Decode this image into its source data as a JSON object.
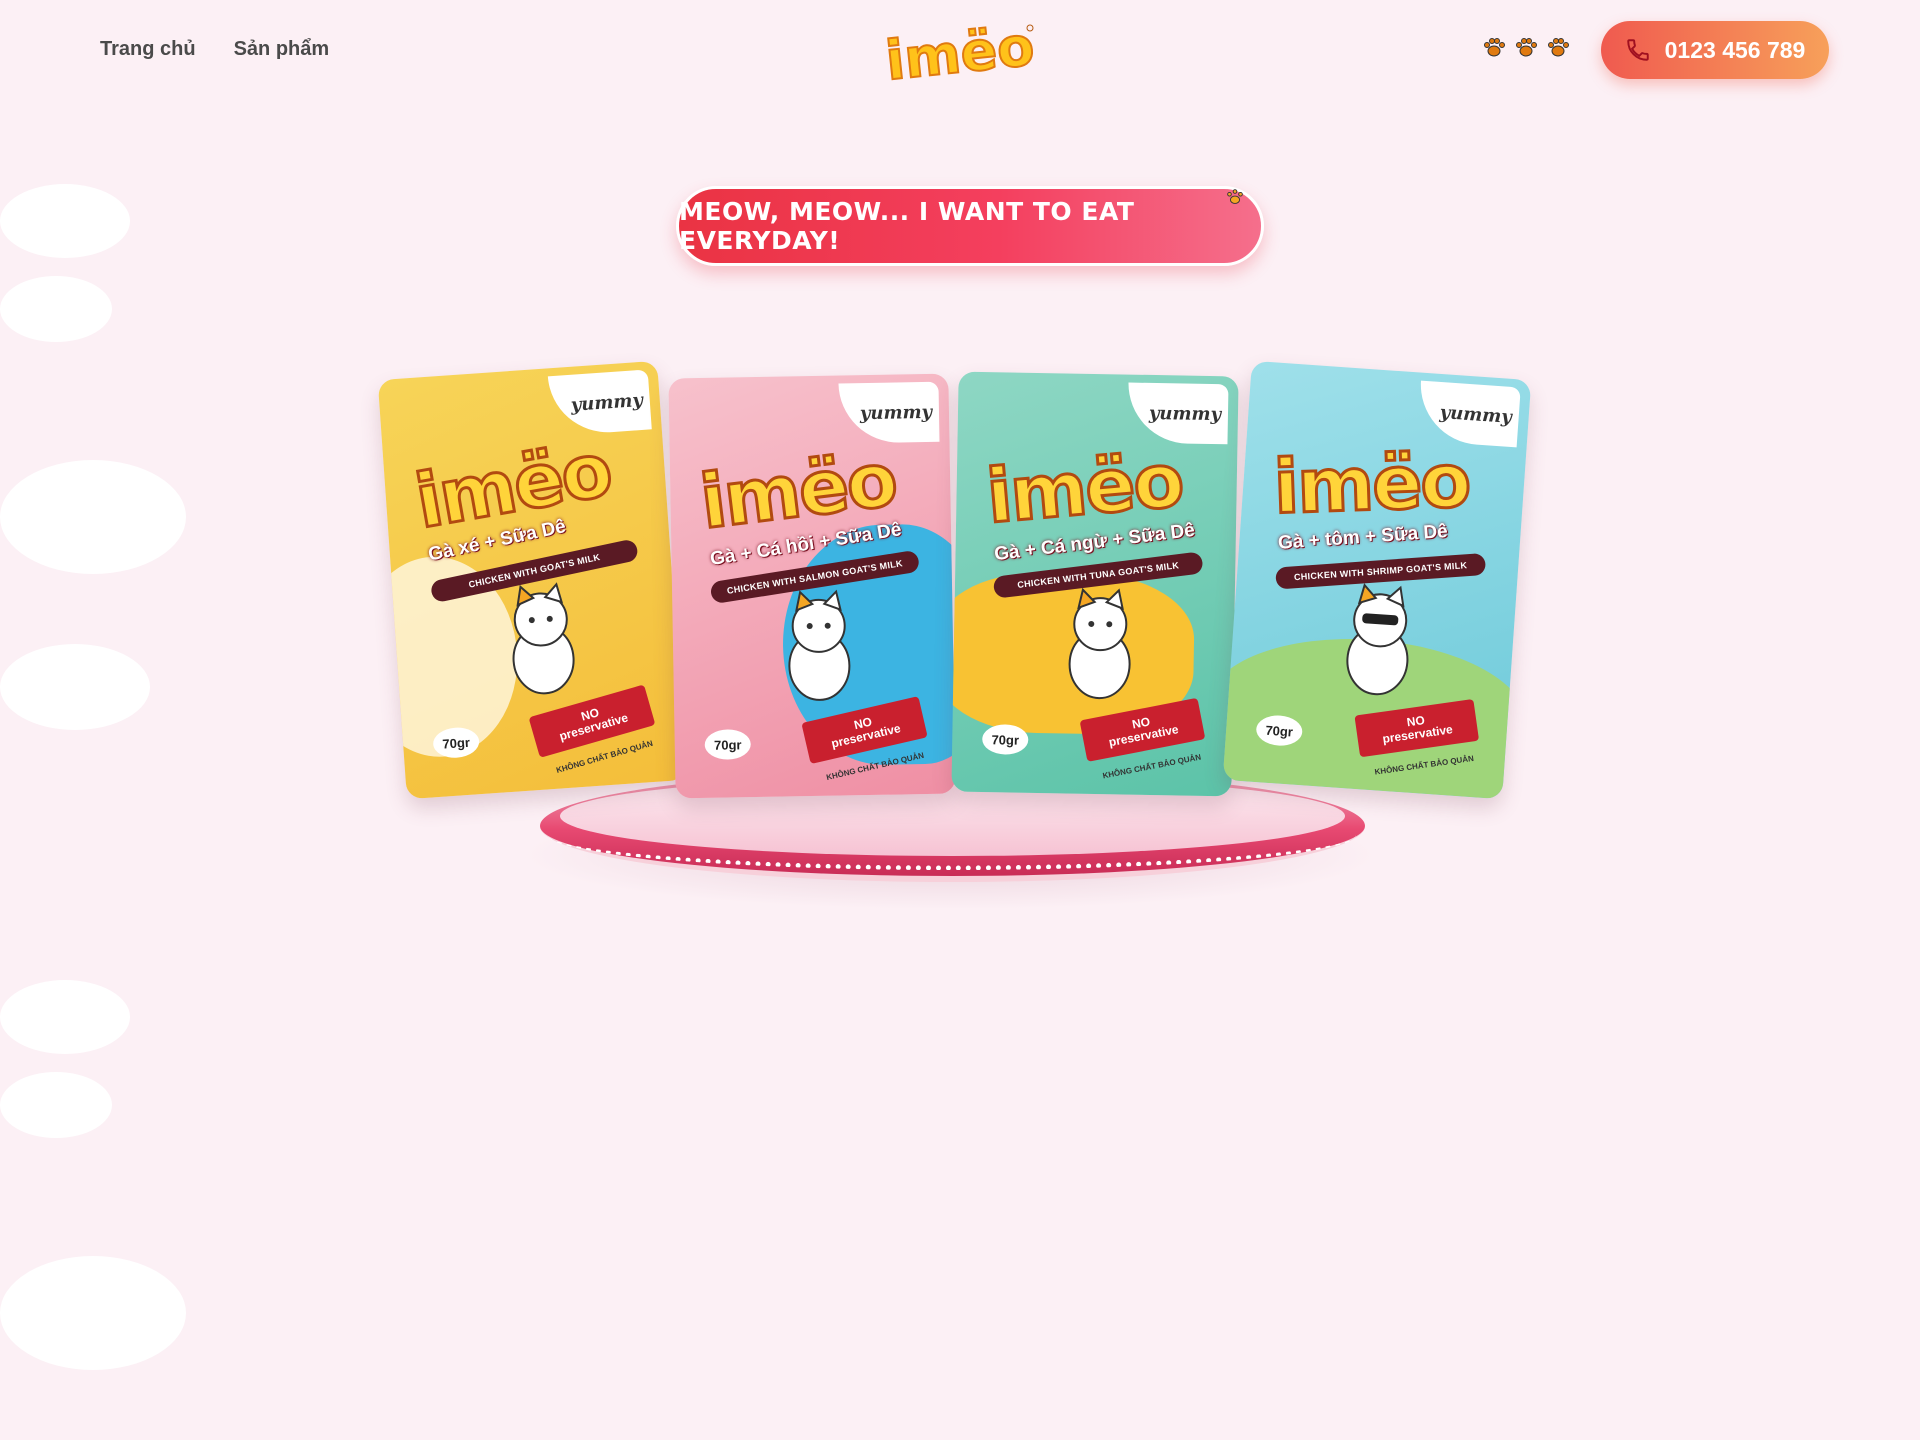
{
  "nav": {
    "home": "Trang chủ",
    "products": "Sản phẩm"
  },
  "logo": {
    "text": "imëo"
  },
  "contact": {
    "phone": "0123 456 789"
  },
  "hero": {
    "slogan": "MEOW, MEOW... I WANT TO EAT EVERYDAY!"
  },
  "products": [
    {
      "brand": "imëo",
      "badge": "yummy",
      "flavor": "Gà xé + Sữa Dê",
      "subtitle": "CHICKEN WITH GOAT'S MILK",
      "ribbon_line1": "NO",
      "ribbon_line2": "preservative",
      "ribbon_sub": "KHÔNG CHẤT BẢO QUẢN",
      "weight": "70gr",
      "color": "#f5c842"
    },
    {
      "brand": "imëo",
      "badge": "yummy",
      "flavor": "Gà + Cá hồi + Sữa Dê",
      "subtitle": "CHICKEN WITH SALMON GOAT'S MILK",
      "ribbon_line1": "NO",
      "ribbon_line2": "preservative",
      "ribbon_sub": "KHÔNG CHẤT BẢO QUẢN",
      "weight": "70gr",
      "color": "#f2a3b4"
    },
    {
      "brand": "imëo",
      "badge": "yummy",
      "flavor": "Gà + Cá ngừ + Sữa Dê",
      "subtitle": "CHICKEN WITH TUNA GOAT'S MILK",
      "ribbon_line1": "NO",
      "ribbon_line2": "preservative",
      "ribbon_sub": "KHÔNG CHẤT BẢO QUẢN",
      "weight": "70gr",
      "color": "#6ec9b2"
    },
    {
      "brand": "imëo",
      "badge": "yummy",
      "flavor": "Gà + tôm + Sữa Dê",
      "subtitle": "CHICKEN WITH SHRIMP GOAT'S MILK",
      "ribbon_line1": "NO",
      "ribbon_line2": "preservative",
      "ribbon_sub": "KHÔNG CHẤT BẢO QUẢN",
      "weight": "70gr",
      "color": "#7fd1df"
    }
  ],
  "colors": {
    "background": "#fcf0f5",
    "cta_start": "#f05a4f",
    "cta_end": "#f7a05a",
    "slogan": "#ea3343",
    "stage": "#e84a72"
  },
  "icons": {
    "paws": [
      "paw-icon",
      "paw-icon",
      "paw-icon"
    ],
    "phone": "phone-icon"
  }
}
